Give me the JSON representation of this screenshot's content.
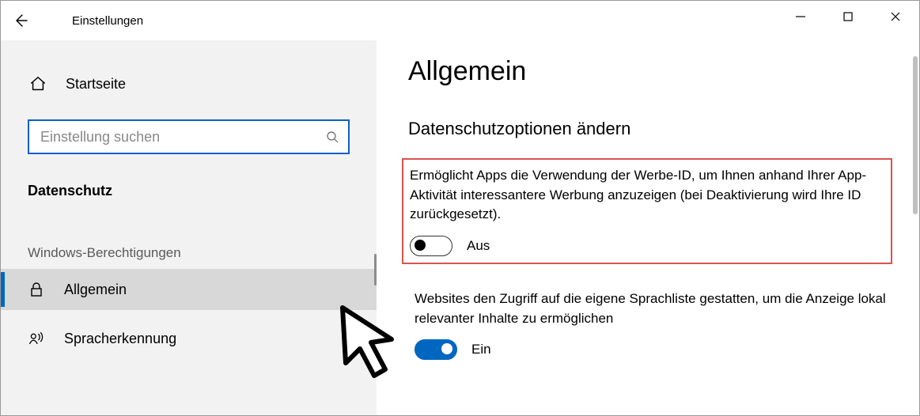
{
  "window": {
    "title": "Einstellungen"
  },
  "sidebar": {
    "home_label": "Startseite",
    "search_placeholder": "Einstellung suchen",
    "section_title": "Datenschutz",
    "group_heading": "Windows-Berechtigungen",
    "items": {
      "allgemein": "Allgemein",
      "spracherkennung": "Spracherkennung"
    }
  },
  "page": {
    "title": "Allgemein",
    "subtitle": "Datenschutzoptionen ändern",
    "setting1": {
      "desc": "Ermöglicht Apps die Verwendung der Werbe-ID, um Ihnen anhand Ihrer App-Aktivität interessantere Werbung anzuzeigen (bei Deaktivierung wird Ihre ID zurückgesetzt).",
      "state_label": "Aus"
    },
    "setting2": {
      "desc": "Websites den Zugriff auf die eigene Sprachliste gestatten, um die Anzeige lokal relevanter Inhalte zu ermöglichen",
      "state_label": "Ein"
    }
  }
}
